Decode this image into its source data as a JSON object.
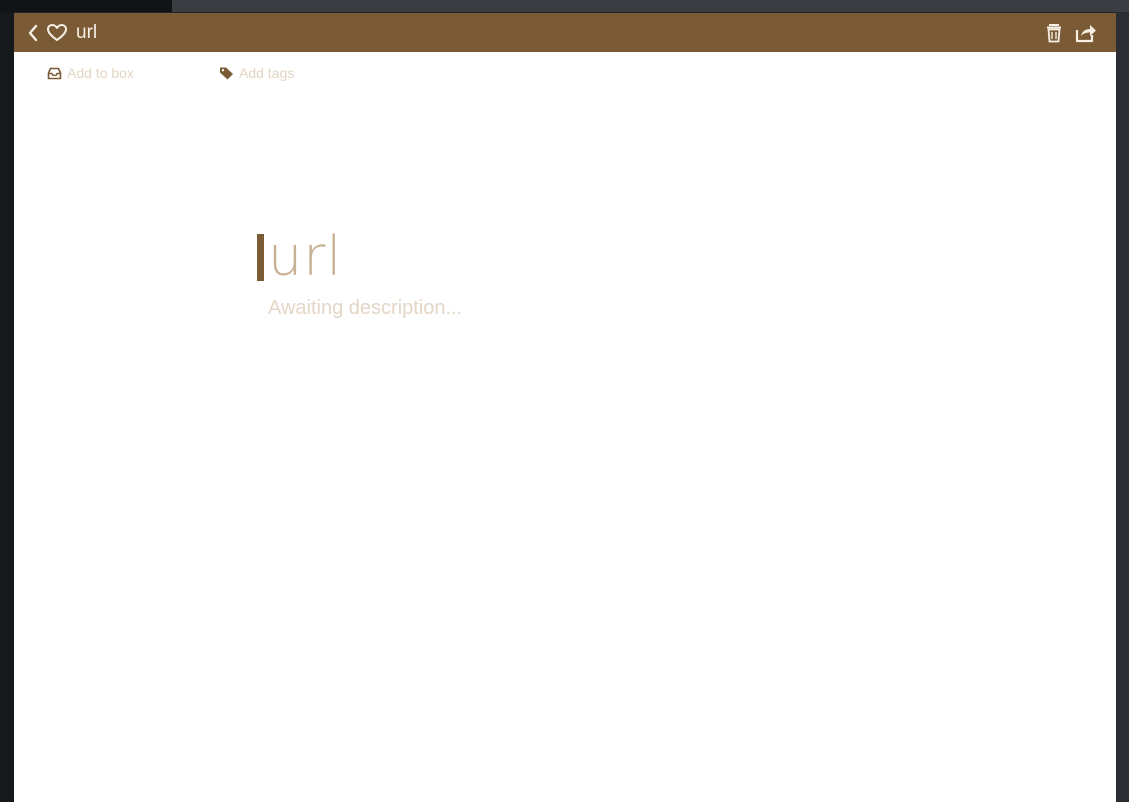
{
  "header": {
    "title": "url",
    "icons": {
      "back": "chevron-left-icon",
      "favorite": "heart-outline-icon",
      "delete": "trash-icon",
      "share": "share-icon"
    }
  },
  "meta": {
    "add_to_box_label": "Add to box",
    "add_tags_label": "Add tags",
    "icons": {
      "box": "inbox-icon",
      "tags": "tag-icon"
    }
  },
  "item": {
    "title": "url",
    "description": "Awaiting description..."
  },
  "colors": {
    "header_bg": "#7b5a36",
    "title_text": "#c8b093",
    "muted_text": "#e3d6c6",
    "window_chrome": "#1f2327"
  }
}
